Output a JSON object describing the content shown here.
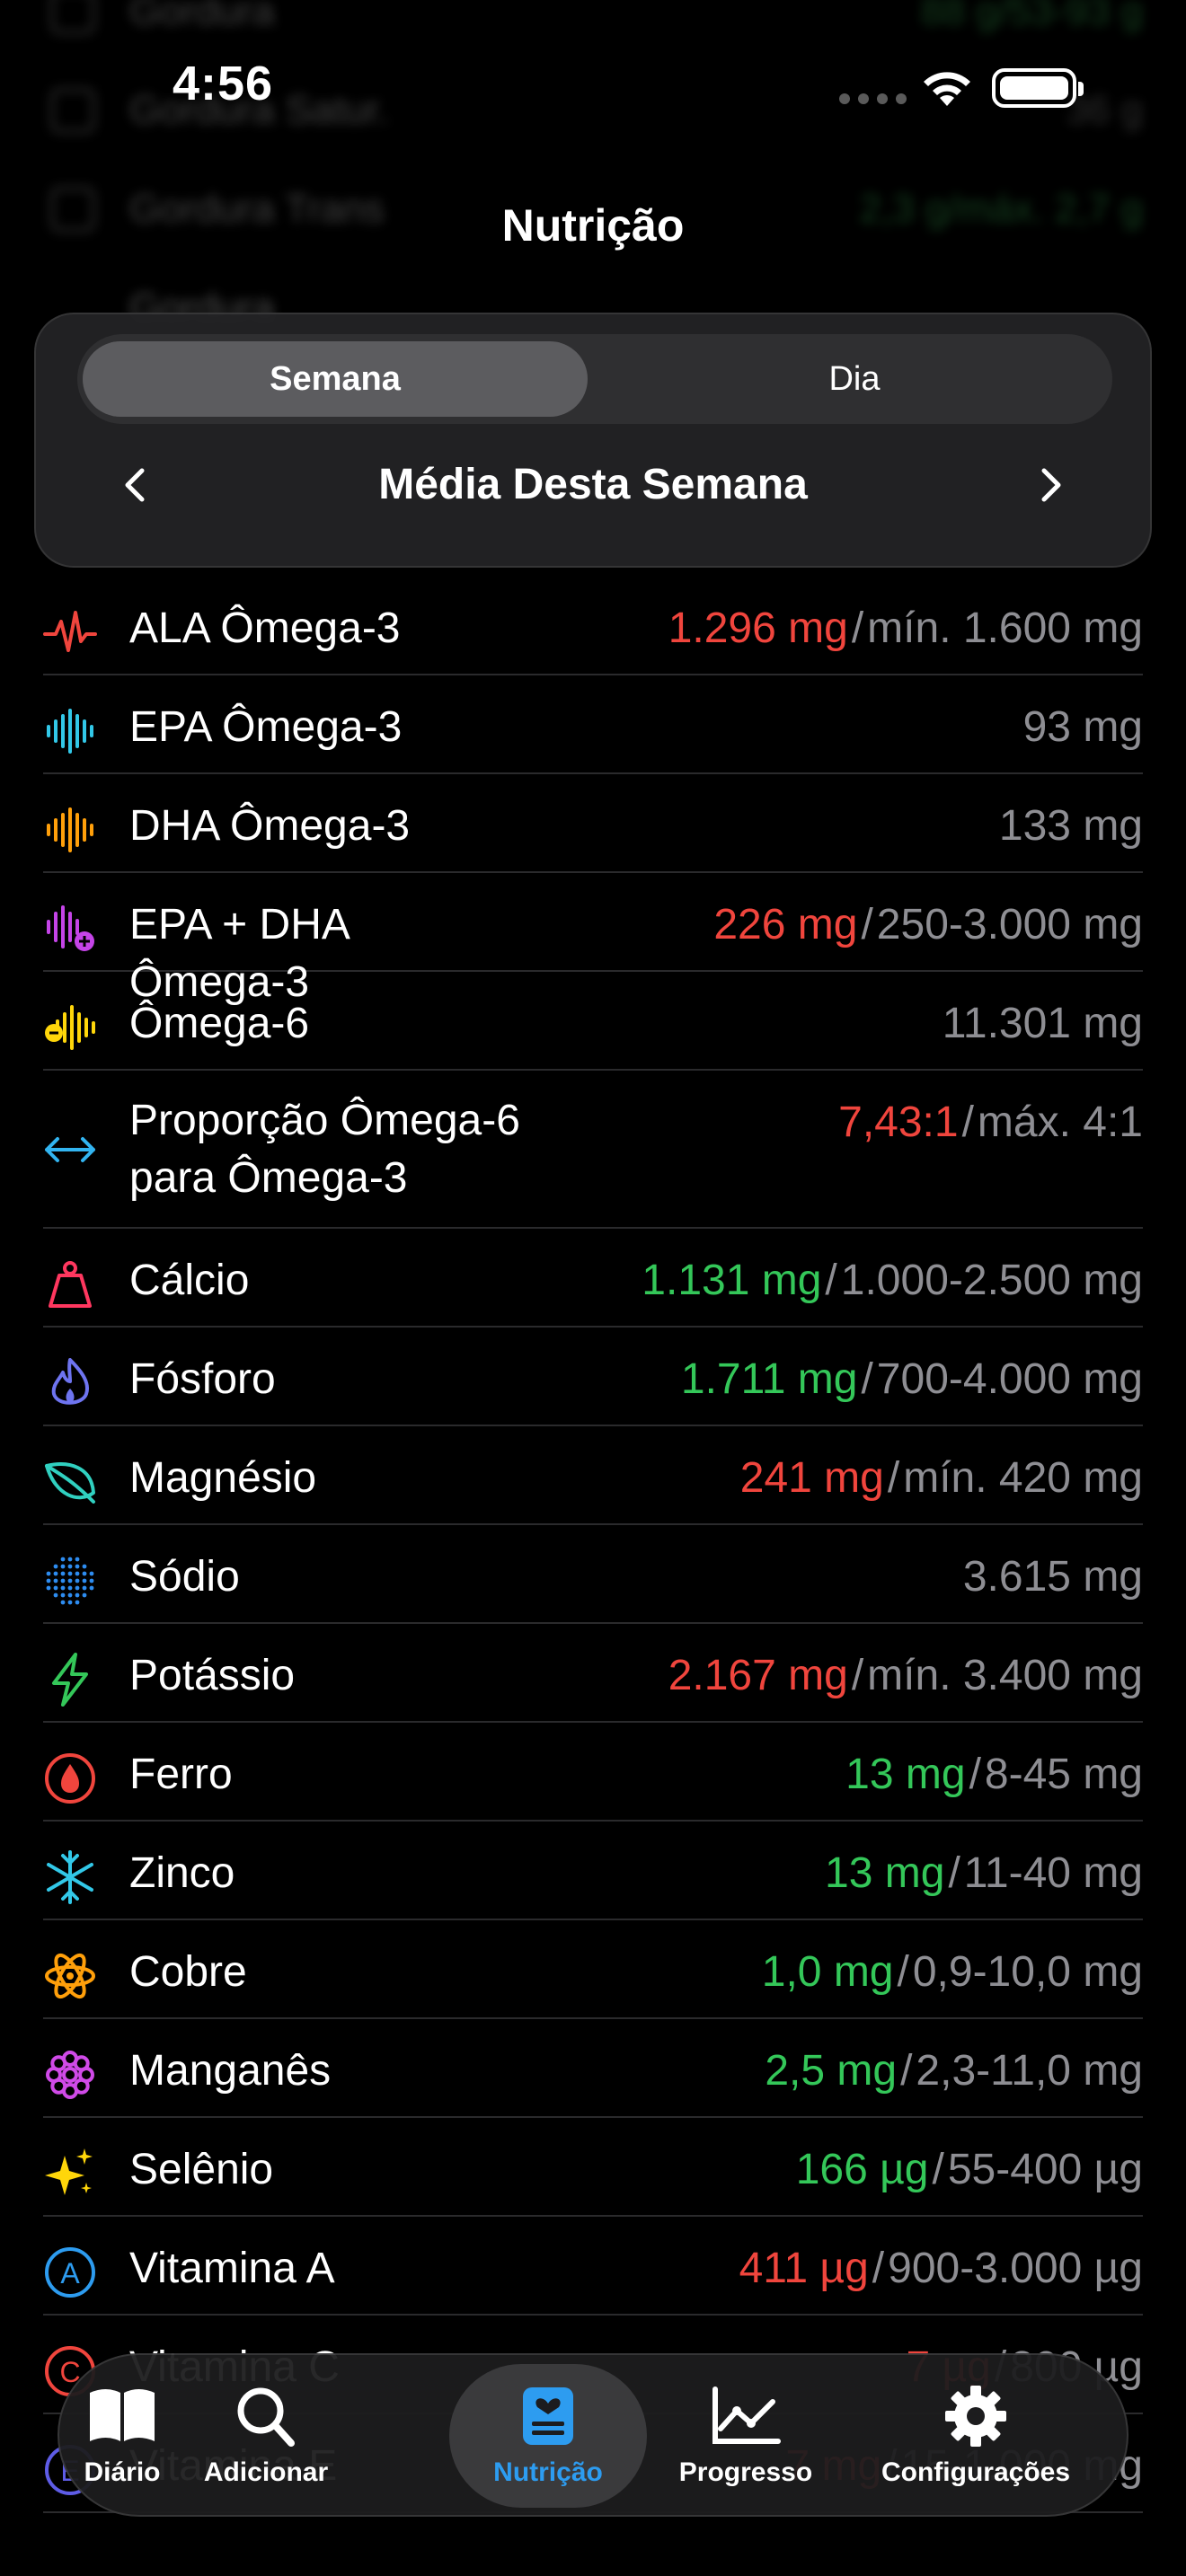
{
  "status_bar": {
    "time": "4:56"
  },
  "page": {
    "title": "Nutrição"
  },
  "background_rows": [
    {
      "label": "Gordura",
      "value": "88 g/53-93 g"
    },
    {
      "label": "Gordura Satur.",
      "value": "36 g"
    },
    {
      "label": "Gordura Trans",
      "value": "2,3 g/máx. 2,7 g"
    },
    {
      "label": "Gordura",
      "value": ""
    }
  ],
  "period": {
    "tabs": [
      {
        "label": "Semana",
        "active": true
      },
      {
        "label": "Dia",
        "active": false
      }
    ],
    "title": "Média Desta Semana"
  },
  "nutrients": [
    {
      "label": "ALA Ômega-3",
      "amount": "1.296 mg",
      "amount_color": "red",
      "target": "mín. 1.600 mg",
      "icon": "wave-pulse-icon",
      "icon_color": "#f0453d"
    },
    {
      "label": "EPA Ômega-3",
      "amount": "93 mg",
      "amount_color": "gray",
      "target": "",
      "icon": "waveform-icon",
      "icon_color": "#32c8e8"
    },
    {
      "label": "DHA Ômega-3",
      "amount": "133 mg",
      "amount_color": "gray",
      "target": "",
      "icon": "waveform-icon",
      "icon_color": "#ff9f0a"
    },
    {
      "label": "EPA + DHA Ômega-3",
      "amount": "226 mg",
      "amount_color": "red",
      "target": "250-3.000 mg",
      "icon": "waveform-plus-icon",
      "icon_color": "#c544e8"
    },
    {
      "label": "Ômega-6",
      "amount": "11.301 mg",
      "amount_color": "gray",
      "target": "",
      "icon": "waveform-minus-icon",
      "icon_color": "#ffd60a"
    },
    {
      "label": "Proporção Ômega-6 para Ômega-3",
      "amount": "7,43:1",
      "amount_color": "red",
      "target": "máx. 4:1",
      "icon": "arrow-left-right-icon",
      "icon_color": "#32b4f0"
    },
    {
      "label": "Cálcio",
      "amount": "1.131 mg",
      "amount_color": "green",
      "target": "1.000-2.500 mg",
      "icon": "weight-icon",
      "icon_color": "#ff375f"
    },
    {
      "label": "Fósforo",
      "amount": "1.711 mg",
      "amount_color": "green",
      "target": "700-4.000 mg",
      "icon": "flame-icon",
      "icon_color": "#6e74f0"
    },
    {
      "label": "Magnésio",
      "amount": "241 mg",
      "amount_color": "red",
      "target": "mín. 420 mg",
      "icon": "leaf-icon",
      "icon_color": "#30d0c0"
    },
    {
      "label": "Sódio",
      "amount": "3.615 mg",
      "amount_color": "gray",
      "target": "",
      "icon": "dots-circle-icon",
      "icon_color": "#2d8cf0"
    },
    {
      "label": "Potássio",
      "amount": "2.167 mg",
      "amount_color": "red",
      "target": "mín. 3.400 mg",
      "icon": "bolt-icon",
      "icon_color": "#34c759"
    },
    {
      "label": "Ferro",
      "amount": "13 mg",
      "amount_color": "green",
      "target": "8-45 mg",
      "icon": "drop-circle-icon",
      "icon_color": "#f0453d"
    },
    {
      "label": "Zinco",
      "amount": "13 mg",
      "amount_color": "green",
      "target": "11-40 mg",
      "icon": "snowflake-icon",
      "icon_color": "#32c8e8"
    },
    {
      "label": "Cobre",
      "amount": "1,0 mg",
      "amount_color": "green",
      "target": "0,9-10,0 mg",
      "icon": "atom-icon",
      "icon_color": "#ff9f0a"
    },
    {
      "label": "Manganês",
      "amount": "2,5 mg",
      "amount_color": "green",
      "target": "2,3-11,0 mg",
      "icon": "flower-icon",
      "icon_color": "#d04ae8"
    },
    {
      "label": "Selênio",
      "amount": "166 µg",
      "amount_color": "green",
      "target": "55-400 µg",
      "icon": "sparkles-icon",
      "icon_color": "#ffd60a"
    },
    {
      "label": "Vitamina A",
      "amount": "411 µg",
      "amount_color": "red",
      "target": "900-3.000 µg",
      "icon": "letter-a-circle-icon",
      "icon_color": "#2d9cf0"
    },
    {
      "label": "Vitamina C",
      "amount": "7 µg",
      "amount_color": "red",
      "target": "800 µg",
      "icon": "letter-c-circle-icon",
      "icon_color": "#f0453d"
    },
    {
      "label": "Vitamina E",
      "amount": "7 mg",
      "amount_color": "red",
      "target": "15-1.000 mg",
      "icon": "letter-e-circle-icon",
      "icon_color": "#5e5ce6"
    }
  ],
  "tab_bar": [
    {
      "label": "Diário",
      "icon": "book-icon",
      "active": false
    },
    {
      "label": "Adicionar",
      "icon": "search-icon",
      "active": false
    },
    {
      "label": "Nutrição",
      "icon": "nutrition-card-icon",
      "active": true
    },
    {
      "label": "Progresso",
      "icon": "chart-line-icon",
      "active": false
    },
    {
      "label": "Configurações",
      "icon": "gear-icon",
      "active": false
    }
  ]
}
